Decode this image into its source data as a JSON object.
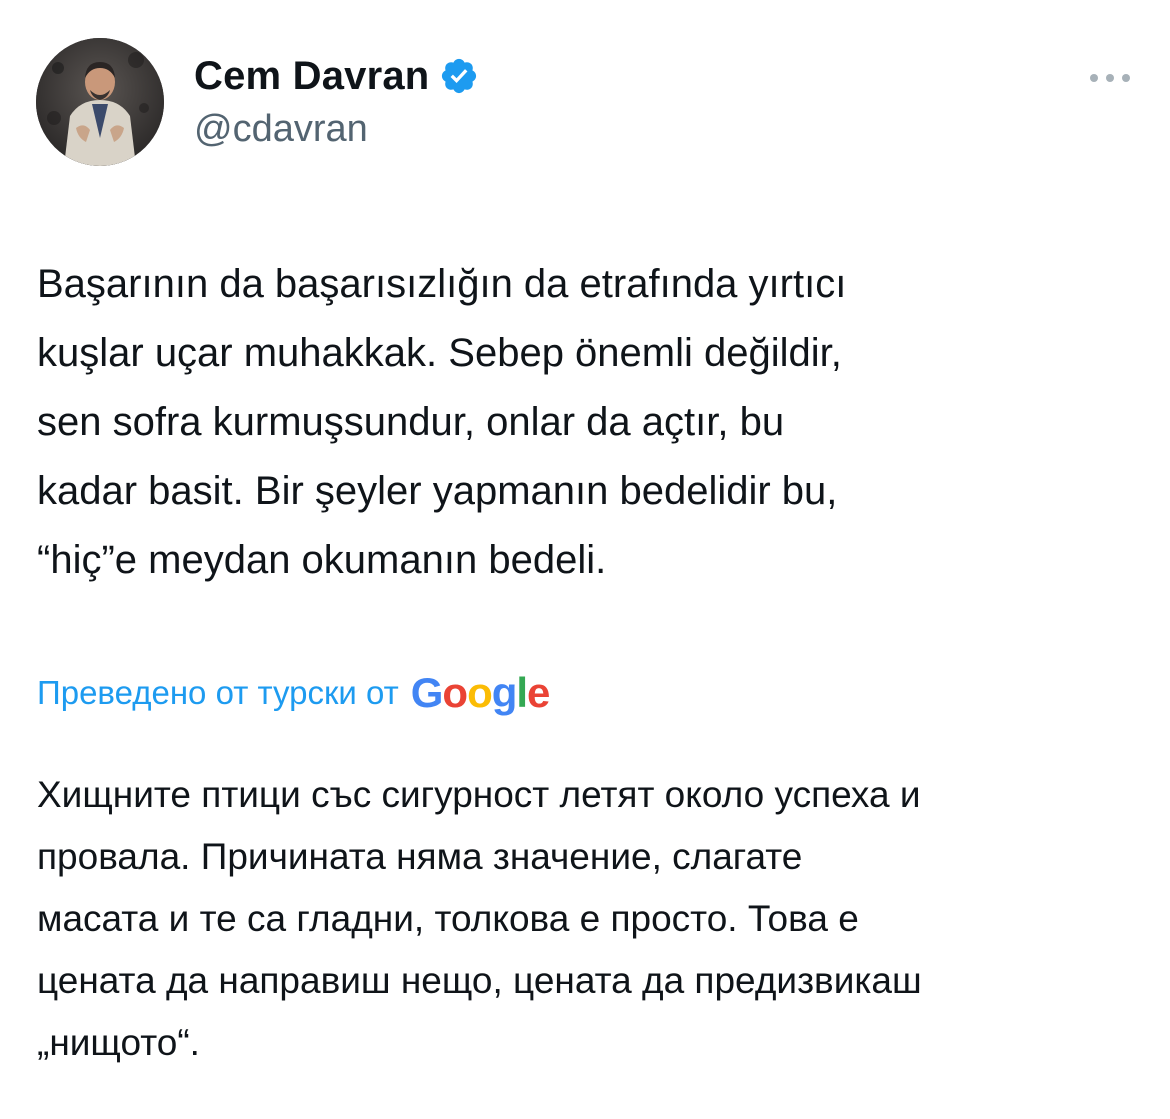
{
  "author": {
    "display_name": "Cem Davran",
    "handle": "@cdavran",
    "verified": true,
    "avatar": "avatar-photo",
    "verified_badge_color": "#1d9bf0"
  },
  "menu": {
    "icon": "more-horizontal-icon"
  },
  "tweet": {
    "text": "Başarının da başarısızlığın da etrafında yırtıcı\nkuşlar uçar muhakkak. Sebep önemli değildir,\nsen sofra kurmuşsundur, onlar da açtır, bu\nkadar basit. Bir şeyler yapmanın bedelidir bu,\n“hiç”e meydan okumanın bedeli."
  },
  "translation": {
    "label": "Преведено от турски от",
    "provider": {
      "G": "G",
      "o1": "o",
      "o2": "o",
      "g": "g",
      "l": "l",
      "e": "e"
    },
    "text": "Хищните птици със сигурност летят около успеха и\nпровала. Причината няма значение, слагате\nмасата и те са гладни, толкова е просто. Това е\nцената да направиш нещо, цената да предизвикаш\n„нищото“.",
    "link_color": "#1d9bf0"
  }
}
